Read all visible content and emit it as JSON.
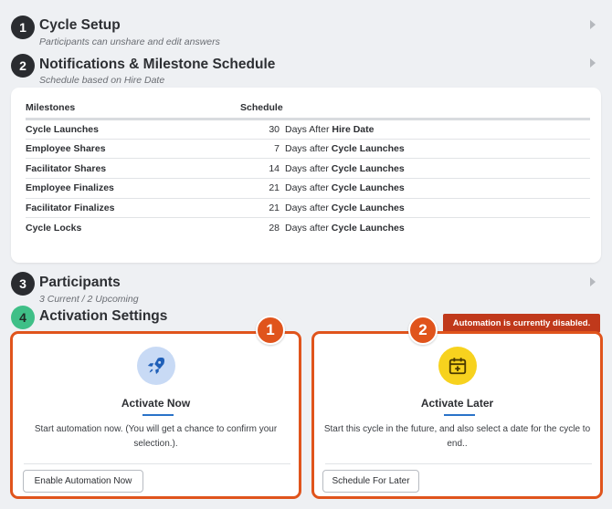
{
  "steps": [
    {
      "number": "1",
      "title": "Cycle Setup",
      "subtitle": "Participants can unshare and edit answers"
    },
    {
      "number": "2",
      "title": "Notifications & Milestone Schedule",
      "subtitle": "Schedule based on Hire Date"
    },
    {
      "number": "3",
      "title": "Participants",
      "subtitle": "3 Current / 2 Upcoming"
    },
    {
      "number": "4",
      "title": "Activation Settings"
    }
  ],
  "milestones": {
    "headers": {
      "milestone": "Milestones",
      "schedule": "Schedule"
    },
    "rows": [
      {
        "name": "Cycle Launches",
        "num": "30",
        "text": "Days After",
        "ref": "Hire Date"
      },
      {
        "name": "Employee Shares",
        "num": "7",
        "text": "Days after",
        "ref": "Cycle Launches"
      },
      {
        "name": "Facilitator Shares",
        "num": "14",
        "text": "Days after",
        "ref": "Cycle Launches"
      },
      {
        "name": "Employee Finalizes",
        "num": "21",
        "text": "Days after",
        "ref": "Cycle Launches"
      },
      {
        "name": "Facilitator Finalizes",
        "num": "21",
        "text": "Days after",
        "ref": "Cycle Launches"
      },
      {
        "name": "Cycle Locks",
        "num": "28",
        "text": "Days after",
        "ref": "Cycle Launches"
      }
    ]
  },
  "activation": {
    "now": {
      "badge": "1",
      "title": "Activate Now",
      "description": "Start automation now. (You will get a chance to confirm your selection.).",
      "button": "Enable Automation Now",
      "icon": "rocket-icon"
    },
    "later": {
      "badge": "2",
      "title": "Activate Later",
      "description": "Start this cycle in the future, and also select a date for the cycle to end..",
      "button": "Schedule For Later",
      "icon": "calendar-plus-icon"
    },
    "disabled_notice": "Automation is currently disabled."
  },
  "colors": {
    "accent_orange": "#e0541c",
    "banner_red": "#c0391b",
    "step_green": "#3fbf87",
    "link_blue": "#2a73c8"
  }
}
